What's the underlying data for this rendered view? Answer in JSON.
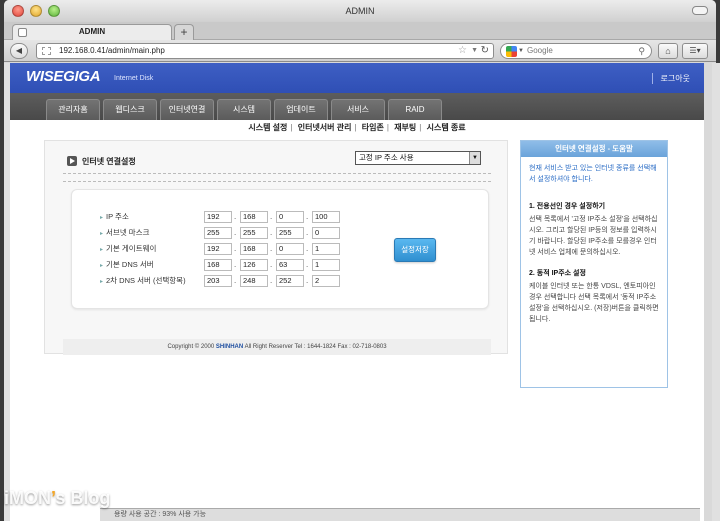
{
  "window": {
    "title": "ADMIN"
  },
  "tabs": [
    {
      "label": "ADMIN"
    }
  ],
  "newtab_label": "+",
  "browser": {
    "url": "192.168.0.41/admin/main.php",
    "search_placeholder": "Google"
  },
  "header": {
    "logo": "WISEGIGA",
    "logo_sub": "Internet Disk",
    "logout": "로그아웃"
  },
  "menu": [
    {
      "label": "관리자홈"
    },
    {
      "label": "웹디스크"
    },
    {
      "label": "인터넷연결"
    },
    {
      "label": "시스템"
    },
    {
      "label": "업데이트"
    },
    {
      "label": "서비스"
    },
    {
      "label": "RAID"
    }
  ],
  "subnav": [
    {
      "label": "시스템 설정"
    },
    {
      "label": "인터넷서버 관리"
    },
    {
      "label": "타임존"
    },
    {
      "label": "재부팅"
    },
    {
      "label": "시스템 종료"
    }
  ],
  "section": {
    "title": "인터넷 연결설정",
    "mode_selected": "고정 IP 주소 사용"
  },
  "form": {
    "rows": [
      {
        "label": "IP 주소",
        "octets": [
          "192",
          "168",
          "0",
          "100"
        ]
      },
      {
        "label": "서브넷 마스크",
        "octets": [
          "255",
          "255",
          "255",
          "0"
        ]
      },
      {
        "label": "기본 게이트웨이",
        "octets": [
          "192",
          "168",
          "0",
          "1"
        ]
      },
      {
        "label": "기본 DNS 서버",
        "octets": [
          "168",
          "126",
          "63",
          "1"
        ]
      },
      {
        "label": "2차 DNS 서버 (선택항목)",
        "octets": [
          "203",
          "248",
          "252",
          "2"
        ]
      }
    ],
    "save_label": "설정저장"
  },
  "footer": {
    "prefix": "Copyright © 2000 ",
    "brand": "SHINHAN",
    "suffix": " All Right Reserver Tel : 1644-1824 Fax : 02-718-0803"
  },
  "help": {
    "title": "인터넷 연결설정 - 도움말",
    "intro": "현재 서비스 받고 있는 인터넷 종류를 선택해서 설정하셔야 합니다.",
    "section1_title": "1. 전용선인 경우 설정하기",
    "section1_body": "선택 목록에서 '고정 IP주소 설정'을 선택하십시오. 그리고 할당된 IP등의 정보를 입력하시기 바랍니다. 할당된 IP주소를 모를경우 인터넷 서비스 업체에 문의하십시오.",
    "section2_title": "2. 동적 IP주소 설정",
    "section2_body": "케이블 인터넷 또는 한통 VDSL, 엔토피아인 경우 선택합니다 선택 목록에서 '동적 IP주소 설정'을 선택하십시오. (저장)버튼을 클릭하면 됩니다."
  },
  "watermark": {
    "pre": "iMON",
    "apos": "’",
    "post": "s Blog"
  },
  "bottom_bar": "용량 사용 공간 : 93% 사용 가능"
}
